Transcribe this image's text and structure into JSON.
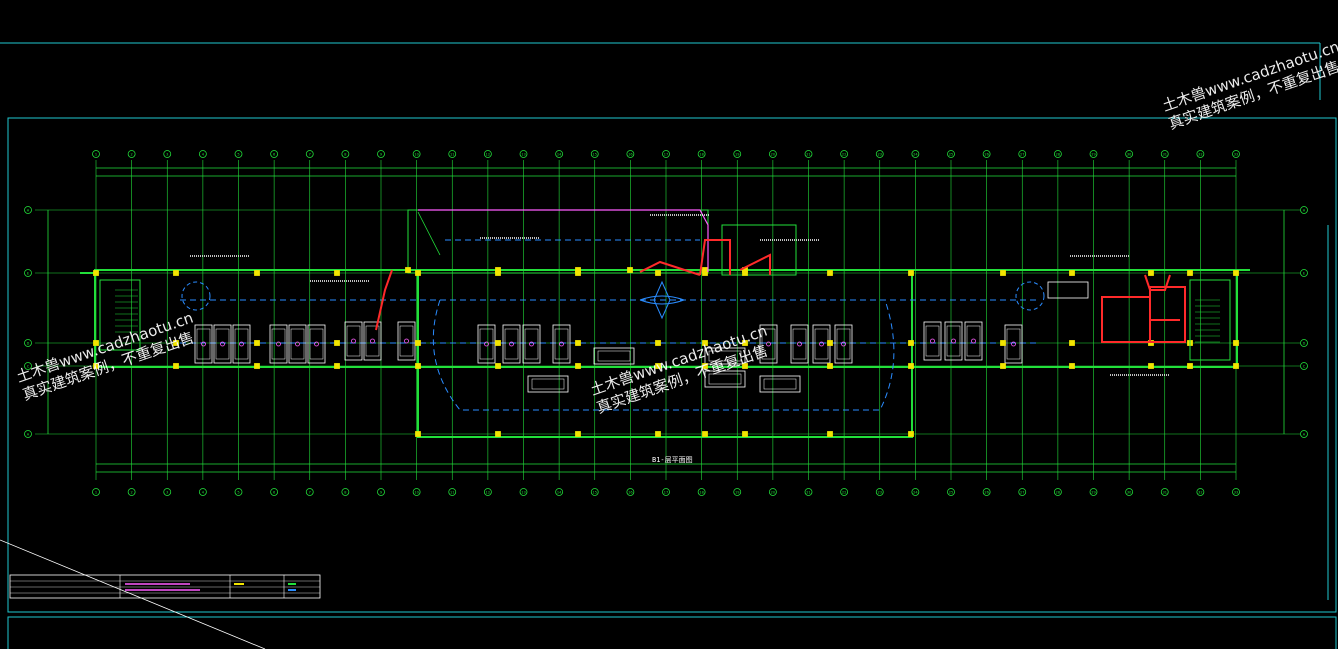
{
  "drawing": {
    "title": "B1-层平面图",
    "columns_top": [
      "1",
      "2",
      "3",
      "4",
      "5",
      "6",
      "7",
      "8",
      "9",
      "10",
      "11",
      "12",
      "13",
      "14",
      "15",
      "16",
      "17",
      "18",
      "19",
      "20",
      "21",
      "22",
      "23",
      "24",
      "25",
      "26",
      "27",
      "28",
      "29",
      "30",
      "31",
      "32",
      "33"
    ],
    "rows_left": [
      "H",
      "E",
      "D",
      "C",
      "A"
    ],
    "rows_right": [
      "H",
      "E",
      "D",
      "C",
      "A"
    ]
  },
  "watermarks": [
    {
      "line1": "土木兽www.cadzhaotu.cn",
      "line2": "真实建筑案例，不重复出售"
    },
    {
      "line1": "土木兽www.cadzhaotu.cn",
      "line2": "真实建筑案例，不重复出售"
    },
    {
      "line1": "土木兽www.cadzhaotu.cn",
      "line2": "真实建筑案例，不重复出售"
    }
  ],
  "colors": {
    "frame": "#1fc8d0",
    "axis": "#22e03a",
    "wall": "#22e03a",
    "duct": "#ff2a2a",
    "pipe": "#ff5cff",
    "dash": "#2a8cff",
    "car": "#ffffff",
    "column": "#f2e400"
  }
}
